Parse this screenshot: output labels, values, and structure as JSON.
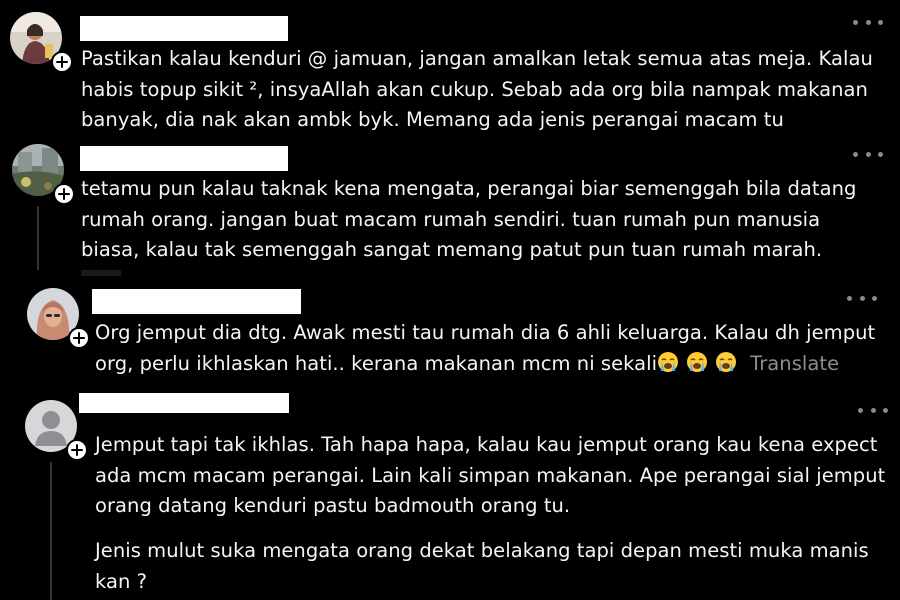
{
  "comments": [
    {
      "lines": [
        "Pastikan kalau kenduri @ jamuan, jangan amalkan letak semua atas meja. Kalau",
        "habis topup sikit ², insyaAllah akan cukup. Sebab ada org bila nampak makanan",
        "banyak, dia nak akan ambk byk. Memang ada jenis perangai macam tu"
      ]
    },
    {
      "lines": [
        "tetamu pun kalau taknak kena mengata, perangai biar semenggah bila datang",
        "rumah orang. jangan buat macam rumah sendiri. tuan rumah pun manusia",
        "biasa, kalau tak semenggah sangat memang patut pun tuan rumah marah."
      ]
    },
    {
      "lines": [
        "Org jemput dia dtg. Awak mesti tau rumah dia 6 ahli keluarga. Kalau dh jemput",
        "org, perlu ikhlaskan hati.. kerana makanan mcm ni sekali"
      ],
      "translate_label": "Translate"
    },
    {
      "lines": [
        "Jemput tapi tak ikhlas. Tah hapa hapa, kalau kau jemput orang kau kena expect",
        "ada mcm macam perangai. Lain kali simpan makanan. Ape perangai sial jemput",
        "orang datang kenduri pastu badmouth orang tu."
      ],
      "para2": [
        "Jenis mulut suka mengata orang dekat belakang tapi depan mesti muka manis",
        "kan ?"
      ]
    }
  ],
  "icons": {
    "more": "more-horizontal-icon",
    "plus": "plus-icon",
    "emoji": "loudly-crying-face-emoji"
  },
  "colors": {
    "background": "#000000",
    "text": "#f5f5f5",
    "muted": "#8e8e8e"
  }
}
